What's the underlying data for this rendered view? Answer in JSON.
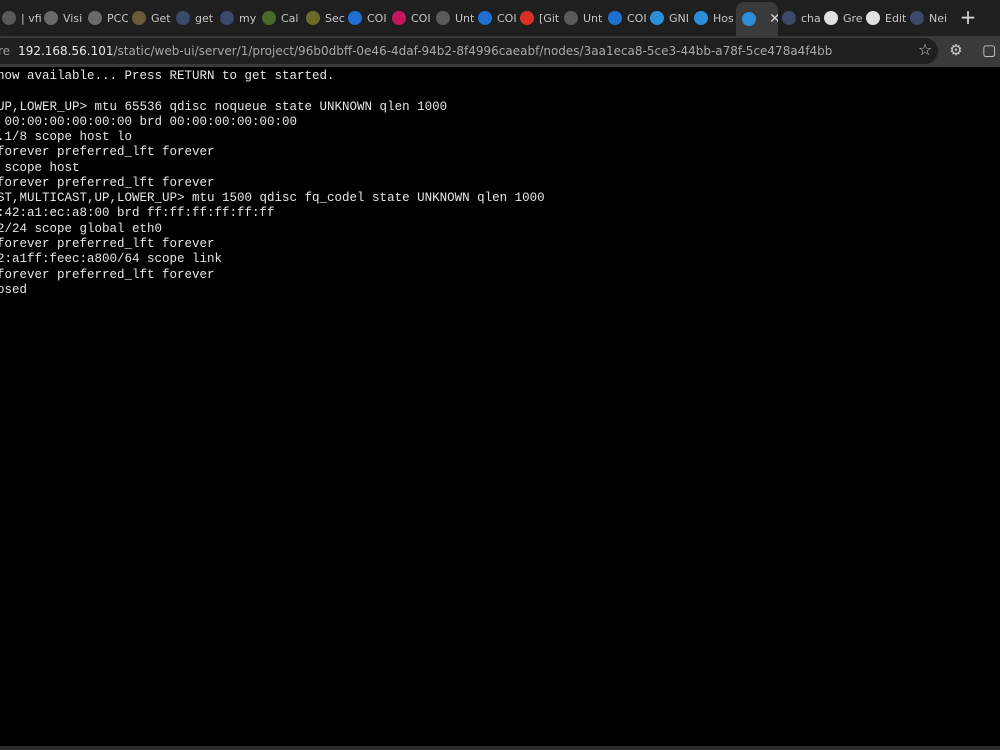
{
  "browser": {
    "tabs": [
      {
        "label": "| vfi",
        "favicon_color": "#5a5a5a"
      },
      {
        "label": "Visi",
        "favicon_color": "#6a6a6a"
      },
      {
        "label": "PCC",
        "favicon_color": "#6a6a6a"
      },
      {
        "label": "Get",
        "favicon_color": "#6a5a3a"
      },
      {
        "label": "get",
        "favicon_color": "#3a4a6a"
      },
      {
        "label": "my",
        "favicon_color": "#3a4a6a"
      },
      {
        "label": "Cal",
        "favicon_color": "#4a6a2a"
      },
      {
        "label": "Sec",
        "favicon_color": "#6a6a2a"
      },
      {
        "label": "COI",
        "favicon_color": "#1f6fd1"
      },
      {
        "label": "COI",
        "favicon_color": "#c2185b"
      },
      {
        "label": "Unt",
        "favicon_color": "#5a5a5a"
      },
      {
        "label": "COI",
        "favicon_color": "#1f6fd1"
      },
      {
        "label": "[Git",
        "favicon_color": "#d93025"
      },
      {
        "label": "Unt",
        "favicon_color": "#5a5a5a"
      },
      {
        "label": "COI",
        "favicon_color": "#1f6fd1"
      },
      {
        "label": "GNI",
        "favicon_color": "#2a8fd8"
      },
      {
        "label": "Hos",
        "favicon_color": "#2a8fd8"
      },
      {
        "label": "",
        "favicon_color": "#2a8fd8",
        "active": true
      },
      {
        "label": "cha",
        "favicon_color": "#3a4a6a"
      },
      {
        "label": "Gre",
        "favicon_color": "#e0e0e0"
      },
      {
        "label": "Edit",
        "favicon_color": "#e0e0e0"
      },
      {
        "label": "Nei",
        "favicon_color": "#3a4a6a"
      }
    ],
    "active_tab_close": "✕",
    "new_tab": "+",
    "address": {
      "prefix": "re",
      "host": "192.168.56.101",
      "path": "/static/web-ui/server/1/project/96b0dbff-0e46-4daf-94b2-8f4996caeabf/nodes/3aa1eca8-5ce3-44bb-a78f-5ce478a4f4bb"
    },
    "icons": {
      "star": "☆",
      "extensions": "⚙",
      "copilot": "▢"
    }
  },
  "terminal": {
    "lines": [
      "now available... Press RETURN to get started.",
      "",
      "UP,LOWER_UP> mtu 65536 qdisc noqueue state UNKNOWN qlen 1000",
      " 00:00:00:00:00:00 brd 00:00:00:00:00:00",
      ".1/8 scope host lo",
      "forever preferred_lft forever",
      " scope host",
      "forever preferred_lft forever",
      "ST,MULTICAST,UP,LOWER_UP> mtu 1500 qdisc fq_codel state UNKNOWN qlen 1000",
      ":42:a1:ec:a8:00 brd ff:ff:ff:ff:ff:ff",
      "2/24 scope global eth0",
      "forever preferred_lft forever",
      "2:a1ff:feec:a800/64 scope link",
      "forever preferred_lft forever",
      "osed"
    ]
  }
}
